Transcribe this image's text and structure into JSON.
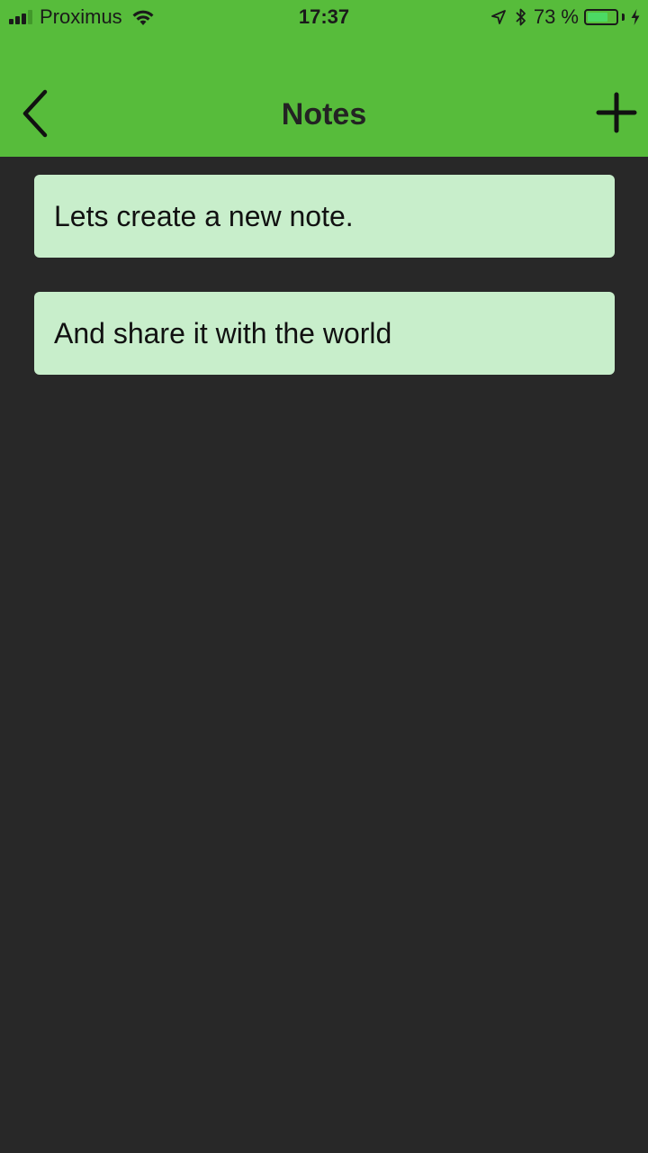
{
  "status_bar": {
    "carrier": "Proximus",
    "time": "17:37",
    "battery_percent": "73 %",
    "battery_level": 0.73,
    "signal_bars_filled": 3,
    "signal_bars_total": 4
  },
  "nav": {
    "title": "Notes",
    "back_icon": "chevron-left-icon",
    "add_icon": "plus-icon"
  },
  "notes": [
    {
      "text": "Lets create a new note."
    },
    {
      "text": "And share it with the world"
    }
  ],
  "colors": {
    "header_bg": "#57bc3b",
    "content_bg": "#282828",
    "note_bg": "#c8eecb",
    "battery_fill": "#4cd964"
  }
}
